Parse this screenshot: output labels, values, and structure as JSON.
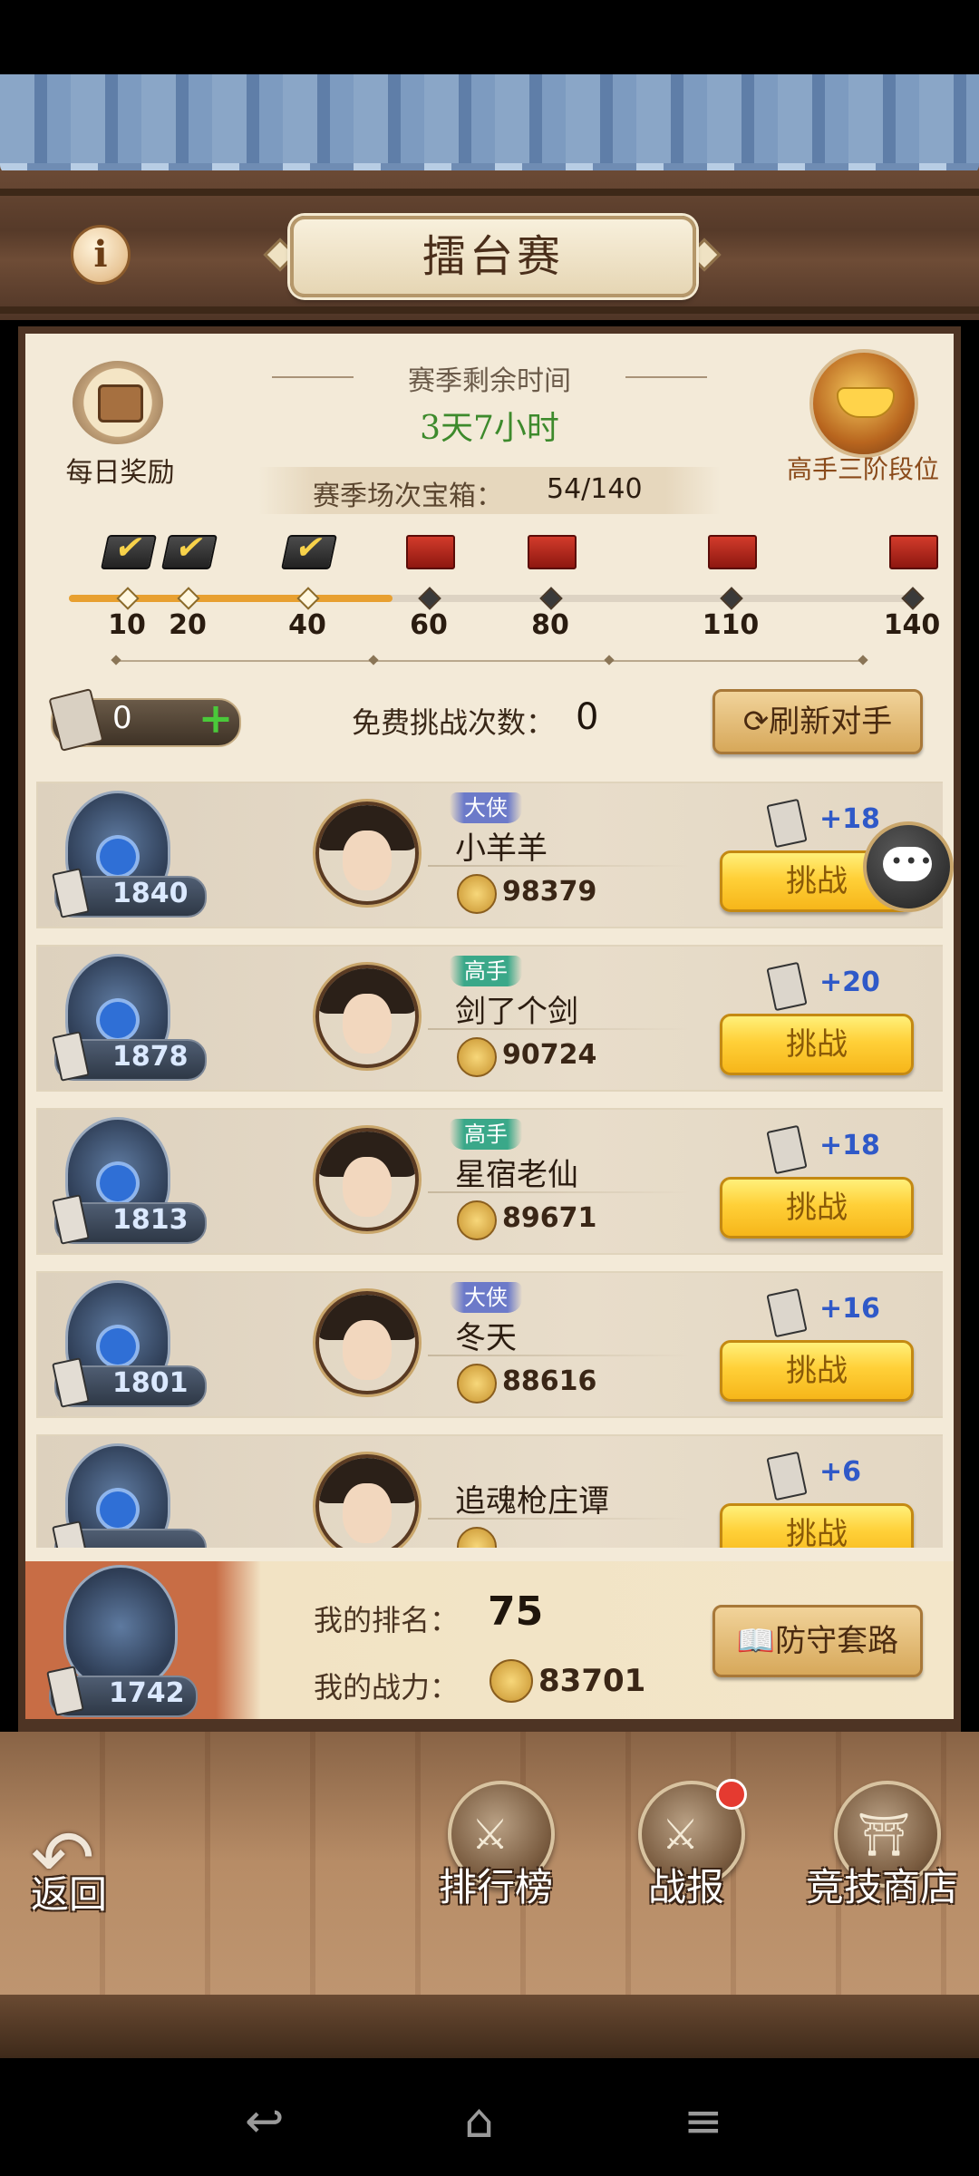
{
  "header": {
    "title": "擂台赛",
    "info_icon": "info-icon"
  },
  "season": {
    "daily_reward_label": "每日奖励",
    "time_label": "赛季剩余时间",
    "time_value": "3天7小时",
    "chest_label": "赛季场次宝箱：",
    "chest_value": "54/140",
    "rank_label": "高手三阶段位"
  },
  "progress": {
    "current": 54,
    "max": 140,
    "milestones": [
      {
        "value": "10",
        "claimed": true
      },
      {
        "value": "20",
        "claimed": true
      },
      {
        "value": "40",
        "claimed": true
      },
      {
        "value": "60",
        "claimed": false
      },
      {
        "value": "80",
        "claimed": false
      },
      {
        "value": "110",
        "claimed": false
      },
      {
        "value": "140",
        "claimed": false
      }
    ]
  },
  "tickets": {
    "count": "0",
    "add_label": "+",
    "free_label": "免费挑战次数：",
    "free_count": "0",
    "refresh_label": "刷新对手"
  },
  "opponents": [
    {
      "score": "1840",
      "tag": "大侠",
      "name": "小羊羊",
      "power": "98379",
      "gain": "+18",
      "button": "挑战"
    },
    {
      "score": "1878",
      "tag": "高手",
      "name": "剑了个剑",
      "power": "90724",
      "gain": "+20",
      "button": "挑战"
    },
    {
      "score": "1813",
      "tag": "高手",
      "name": "星宿老仙",
      "power": "89671",
      "gain": "+18",
      "button": "挑战"
    },
    {
      "score": "1801",
      "tag": "大侠",
      "name": "冬天",
      "power": "88616",
      "gain": "+16",
      "button": "挑战"
    },
    {
      "score": "",
      "tag": "",
      "name": "追魂枪庄谭",
      "power": "",
      "gain": "+6",
      "button": "挑战"
    }
  ],
  "me": {
    "score": "1742",
    "rank_label": "我的排名：",
    "rank": "75",
    "power_label": "我的战力：",
    "power": "83701",
    "defense_label": "防守套路"
  },
  "bottom_nav": {
    "back": "返回",
    "leaderboard": "排行榜",
    "report": "战报",
    "shop": "竞技商店"
  },
  "colors": {
    "accent_gold": "#ffd038",
    "time_green": "#3d8a2c",
    "gain_blue": "#2f59c8",
    "badge_red": "#e53a30"
  }
}
